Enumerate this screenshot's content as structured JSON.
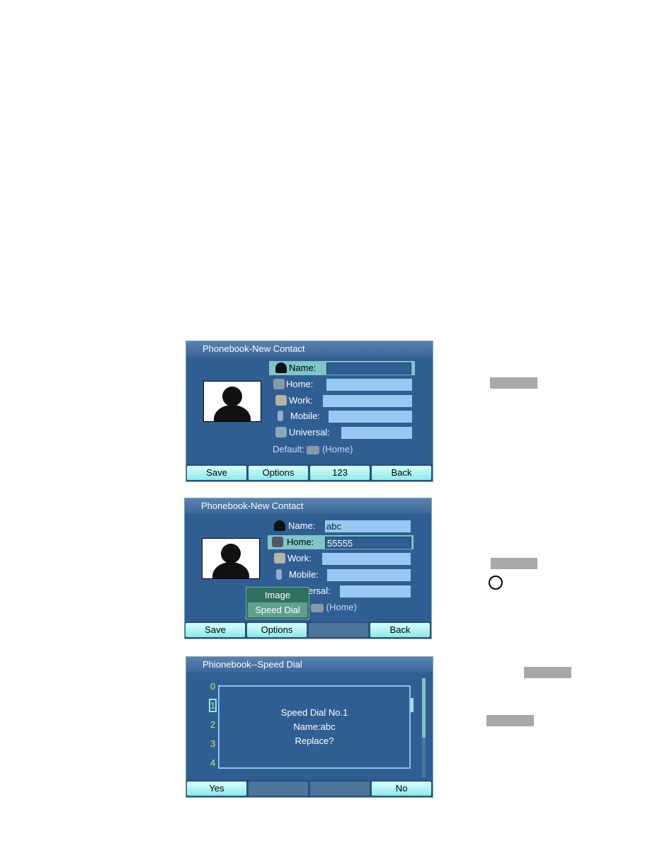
{
  "screen1": {
    "title": "Phonebook-New Contact",
    "fields": [
      {
        "label": "Name:",
        "value": "",
        "icon": "person-icon"
      },
      {
        "label": "Home:",
        "value": "",
        "icon": "home-phone-icon"
      },
      {
        "label": "Work:",
        "value": "",
        "icon": "briefcase-icon"
      },
      {
        "label": "Mobile:",
        "value": "",
        "icon": "mobile-phone-icon"
      },
      {
        "label": "Universal:",
        "value": "",
        "icon": "computer-icon"
      }
    ],
    "default_label": "Default:",
    "default_value": "(Home)",
    "buttons": [
      "Save",
      "Options",
      "123",
      "Back"
    ]
  },
  "screen2": {
    "title": "Phonebook-New Contact",
    "fields": [
      {
        "label": "Name:",
        "value": "abc"
      },
      {
        "label": "Home:",
        "value": "55555"
      },
      {
        "label": "Work:",
        "value": ""
      },
      {
        "label": "Mobile:",
        "value": ""
      },
      {
        "label": "ersal:",
        "value": ""
      }
    ],
    "default_value": "(Home)",
    "menu": [
      "Image",
      "Speed Dial"
    ],
    "buttons": [
      "Save",
      "Options",
      "",
      "Back"
    ]
  },
  "screen3": {
    "title": "Phionebook--Speed Dial",
    "numbers": [
      "0",
      "1",
      "2",
      "3",
      "4"
    ],
    "dialog": [
      "Speed Dial No.1",
      "Name:abc",
      "Replace?"
    ],
    "buttons": [
      "Yes",
      "",
      "",
      "No"
    ]
  },
  "colors": {
    "screen_bg": "#2f5e93",
    "field": "#99c8f5",
    "highlight": "#7fc6c8",
    "button": "#a8f0f0",
    "number": "#d6e060"
  }
}
